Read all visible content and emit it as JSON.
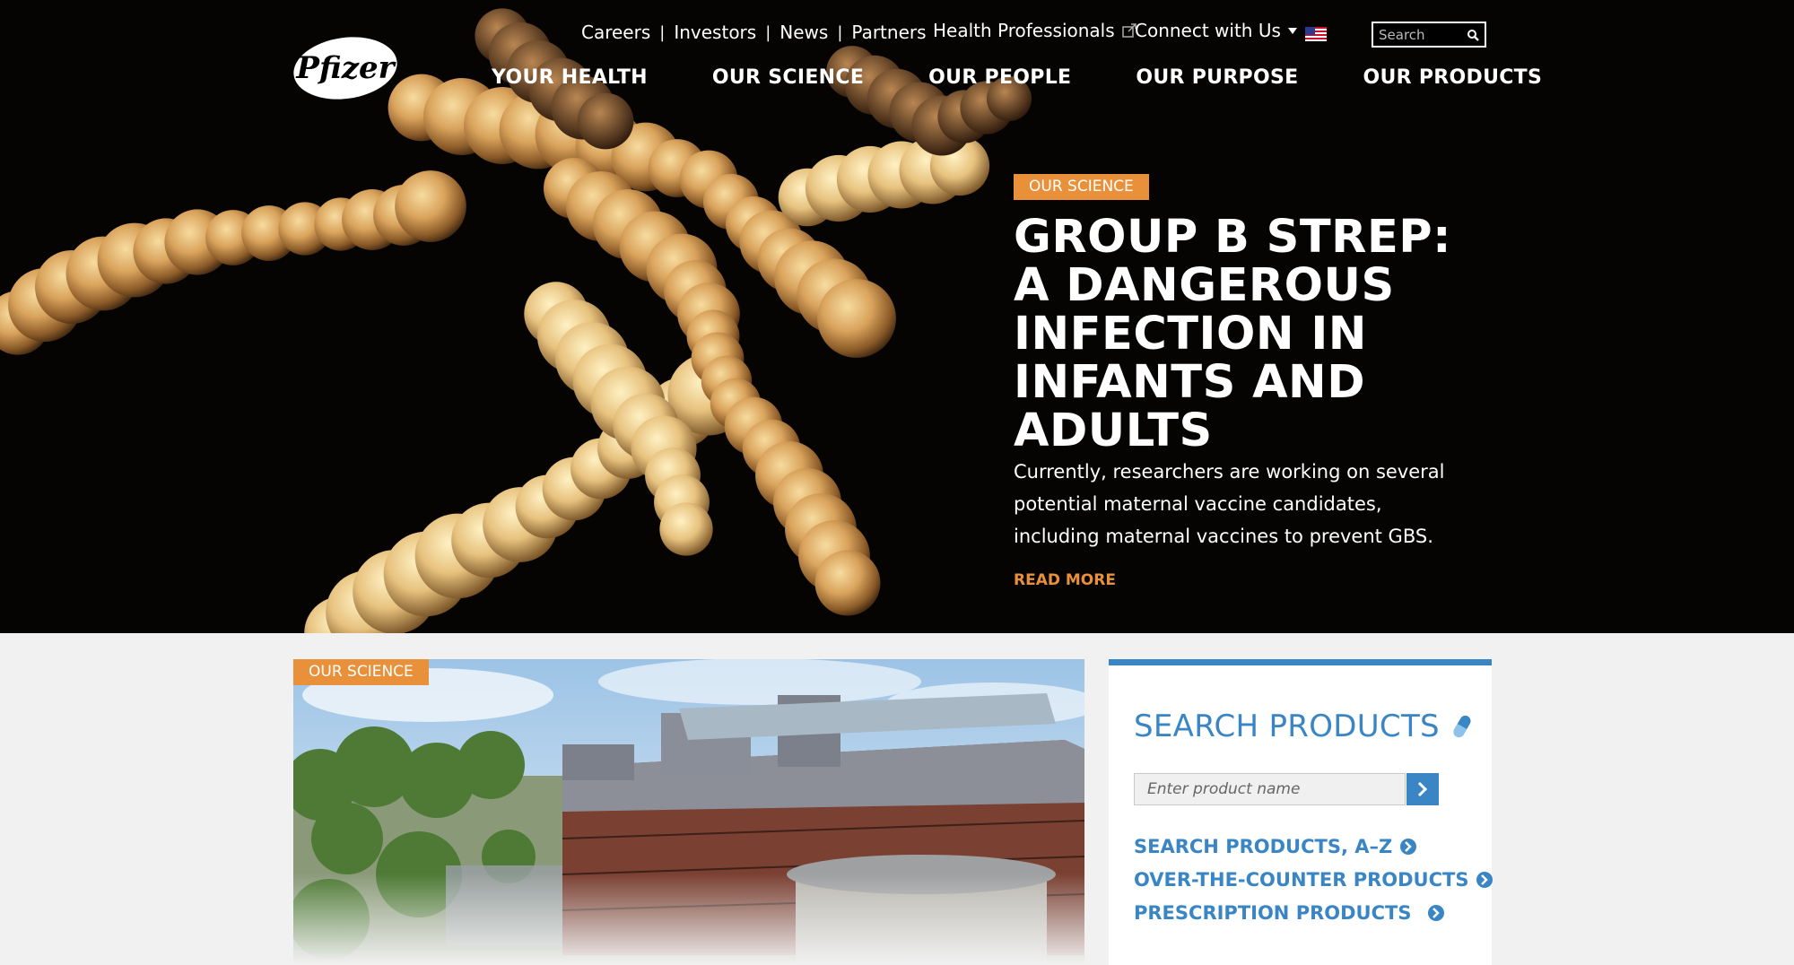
{
  "brand": {
    "logo_text": "Pfizer"
  },
  "utility_nav": {
    "items": [
      "Careers",
      "Investors",
      "News",
      "Partners"
    ],
    "health_professionals": "Health Professionals",
    "connect": "Connect with Us",
    "search_placeholder": "Search"
  },
  "main_nav": [
    "YOUR HEALTH",
    "OUR SCIENCE",
    "OUR PEOPLE",
    "OUR PURPOSE",
    "OUR PRODUCTS"
  ],
  "hero": {
    "tag": "OUR SCIENCE",
    "title_lines": [
      "GROUP B STREP:",
      "A DANGEROUS",
      "INFECTION IN",
      "INFANTS AND",
      "ADULTS"
    ],
    "description": "Currently, researchers are working on several potential maternal vaccine candidates, including maternal vaccines to prevent GBS.",
    "read_more": "READ MORE"
  },
  "feature_card": {
    "tag": "OUR SCIENCE"
  },
  "search_products": {
    "title": "SEARCH PRODUCTS",
    "input_placeholder": "Enter product name",
    "links": [
      "SEARCH PRODUCTS, A–Z",
      "OVER-THE-COUNTER PRODUCTS",
      "PRESCRIPTION PRODUCTS"
    ]
  },
  "colors": {
    "accent_orange": "#e8913a",
    "brand_blue": "#3a86c4",
    "hero_bg": "#050403"
  }
}
